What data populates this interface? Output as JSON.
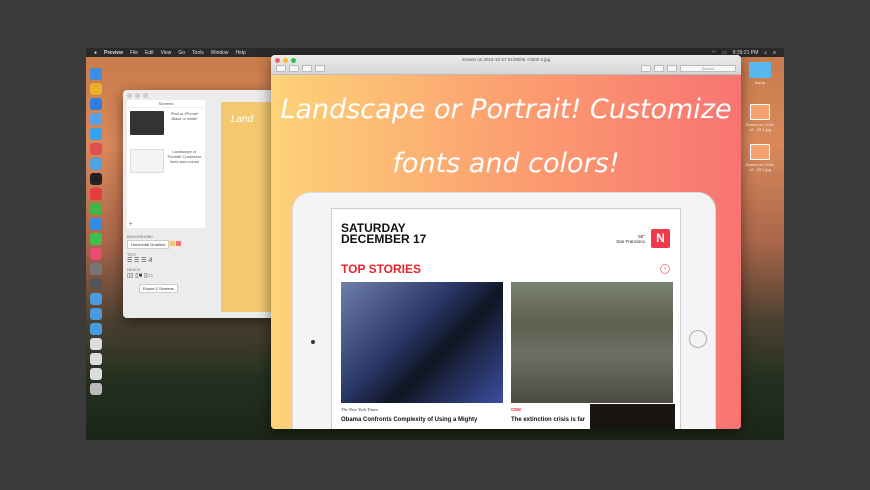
{
  "menubar": {
    "apple": "",
    "items": [
      "Preview",
      "File",
      "Edit",
      "View",
      "Go",
      "Tools",
      "Window",
      "Help"
    ],
    "clock": "8:39:21 PM"
  },
  "editor": {
    "list_header": "Screens",
    "screens": [
      {
        "caption": "iPad or iPhone! Black or white!"
      },
      {
        "caption": "Landscape or Portrait! Customize fonts and colors!"
      }
    ],
    "add": "+",
    "background_label": "BACKGROUND",
    "background_value": "Horizontal Gradient",
    "text_label": "TEXT",
    "device_label": "DEVICE",
    "export_button": "Export 2 Screens",
    "canvas_text": "Land"
  },
  "preview": {
    "title": "Screen on 2016-12-27 01/08/05 +0000 2.jpg",
    "search_placeholder": "Search",
    "headline": "Landscape or Portrait! Customize fonts and colors!",
    "news": {
      "day": "SATURDAY",
      "date": "DECEMBER 17",
      "temp": "50°",
      "city": "San Francisco",
      "section": "TOP STORIES",
      "stories": [
        {
          "source": "The New York Times",
          "title": "Obama Confronts Complexity of Using a Mighty"
        },
        {
          "source": "CNN",
          "title": "The extinction crisis is far"
        }
      ]
    }
  },
  "desktop": {
    "icons": [
      "dump",
      "Screen on 2016-12...09 1.jpg",
      "Screen on 2016-12...09 2.jpg"
    ]
  }
}
